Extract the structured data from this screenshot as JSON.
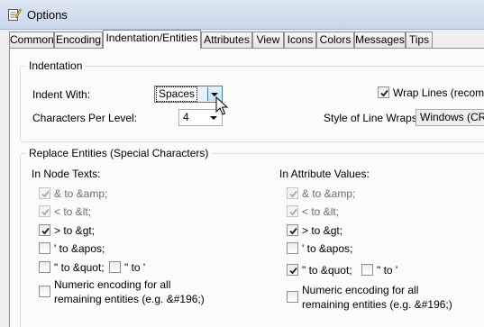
{
  "window": {
    "title": "Options"
  },
  "tabs": [
    {
      "label": "Common"
    },
    {
      "label": "Encoding"
    },
    {
      "label": "Indentation/Entities"
    },
    {
      "label": "Attributes"
    },
    {
      "label": "View"
    },
    {
      "label": "Icons"
    },
    {
      "label": "Colors"
    },
    {
      "label": "Messages"
    },
    {
      "label": "Tips"
    }
  ],
  "indentation": {
    "title": "Indentation",
    "indent_with_label": "Indent With:",
    "indent_with_value": "Spaces",
    "chars_per_level_label": "Characters Per Level:",
    "chars_per_level_value": "4",
    "wrap_lines_label": "Wrap Lines (recomme",
    "wrap_lines_checked": true,
    "style_label": "Style of Line Wraps:",
    "style_value": "Windows (CR L"
  },
  "entities": {
    "title": "Replace Entities (Special Characters)",
    "node": {
      "title": "In Node Texts:",
      "amp": "& to &amp;",
      "lt": "< to &lt;",
      "gt": "> to &gt;",
      "apos": "' to &apos;",
      "quot": "\" to &quot;",
      "quot2": "\" to '",
      "numeric_1": "Numeric encoding for all",
      "numeric_2": "remaining entities (e.g. &#196;)"
    },
    "attr": {
      "title": "In Attribute Values:",
      "amp": "& to &amp;",
      "lt": "< to &lt;",
      "gt": "> to &gt;",
      "apos": "' to &apos;",
      "quot": "\" to &quot;",
      "quot2": "\" to '",
      "numeric_1": "Numeric encoding for all",
      "numeric_2": "remaining entities (e.g. &#196;)"
    }
  }
}
